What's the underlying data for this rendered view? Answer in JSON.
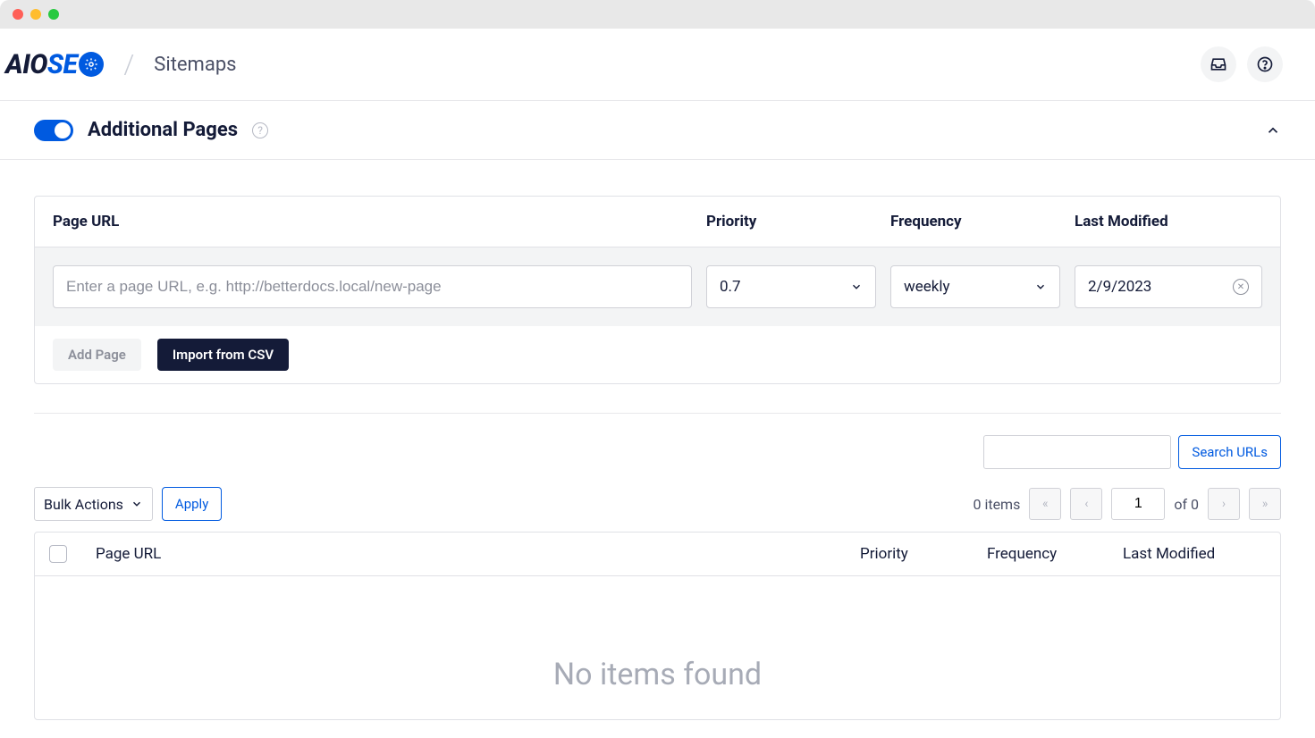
{
  "header": {
    "logo_aio": "AIO",
    "logo_seo": "SE",
    "page_title": "Sitemaps"
  },
  "section": {
    "title": "Additional Pages"
  },
  "form": {
    "headers": {
      "url": "Page URL",
      "priority": "Priority",
      "frequency": "Frequency",
      "modified": "Last Modified"
    },
    "url_placeholder": "Enter a page URL, e.g. http://betterdocs.local/new-page",
    "priority_value": "0.7",
    "frequency_value": "weekly",
    "modified_value": "2/9/2023",
    "add_page_label": "Add Page",
    "import_csv_label": "Import from CSV"
  },
  "search": {
    "button_label": "Search URLs"
  },
  "bulk": {
    "select_label": "Bulk Actions",
    "apply_label": "Apply"
  },
  "pagination": {
    "count_text": "0 items",
    "page_value": "1",
    "of_text": "of 0"
  },
  "table": {
    "headers": {
      "url": "Page URL",
      "priority": "Priority",
      "frequency": "Frequency",
      "modified": "Last Modified"
    },
    "empty_text": "No items found"
  }
}
